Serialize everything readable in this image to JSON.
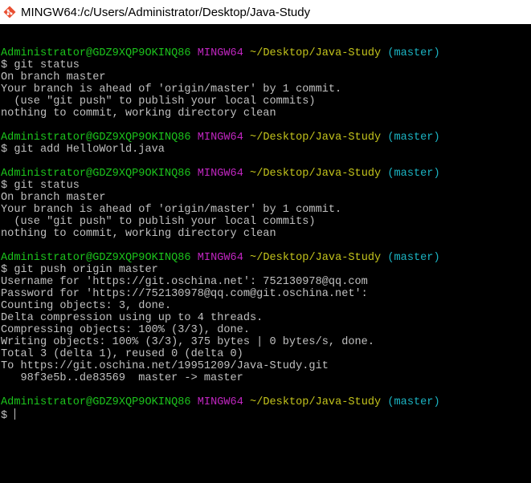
{
  "window": {
    "title": "MINGW64:/c/Users/Administrator/Desktop/Java-Study"
  },
  "colors": {
    "user": "#1cc51c",
    "host": "#c026c0",
    "path": "#c4c41c",
    "branch": "#1cb5c4",
    "text": "#c0c0c0",
    "background": "#000000"
  },
  "prompt": {
    "user": "Administrator@GDZ9XQP9OKINQ86",
    "host": "MINGW64",
    "path": "~/Desktop/Java-Study",
    "branch": "(master)"
  },
  "terminal": {
    "lines": [
      {
        "type": "blank"
      },
      {
        "type": "prompt"
      },
      {
        "type": "text",
        "text": "$ git status"
      },
      {
        "type": "text",
        "text": "On branch master"
      },
      {
        "type": "text",
        "text": "Your branch is ahead of 'origin/master' by 1 commit."
      },
      {
        "type": "text",
        "text": "  (use \"git push\" to publish your local commits)"
      },
      {
        "type": "text",
        "text": "nothing to commit, working directory clean"
      },
      {
        "type": "blank"
      },
      {
        "type": "prompt"
      },
      {
        "type": "text",
        "text": "$ git add HelloWorld.java"
      },
      {
        "type": "blank"
      },
      {
        "type": "prompt"
      },
      {
        "type": "text",
        "text": "$ git status"
      },
      {
        "type": "text",
        "text": "On branch master"
      },
      {
        "type": "text",
        "text": "Your branch is ahead of 'origin/master' by 1 commit."
      },
      {
        "type": "text",
        "text": "  (use \"git push\" to publish your local commits)"
      },
      {
        "type": "text",
        "text": "nothing to commit, working directory clean"
      },
      {
        "type": "blank"
      },
      {
        "type": "prompt"
      },
      {
        "type": "text",
        "text": "$ git push origin master"
      },
      {
        "type": "text",
        "text": "Username for 'https://git.oschina.net': 752130978@qq.com"
      },
      {
        "type": "text",
        "text": "Password for 'https://752130978@qq.com@git.oschina.net':"
      },
      {
        "type": "text",
        "text": "Counting objects: 3, done."
      },
      {
        "type": "text",
        "text": "Delta compression using up to 4 threads."
      },
      {
        "type": "text",
        "text": "Compressing objects: 100% (3/3), done."
      },
      {
        "type": "text",
        "text": "Writing objects: 100% (3/3), 375 bytes | 0 bytes/s, done."
      },
      {
        "type": "text",
        "text": "Total 3 (delta 1), reused 0 (delta 0)"
      },
      {
        "type": "text",
        "text": "To https://git.oschina.net/19951209/Java-Study.git"
      },
      {
        "type": "text",
        "text": "   98f3e5b..de83569  master -> master"
      },
      {
        "type": "blank"
      },
      {
        "type": "prompt"
      },
      {
        "type": "input",
        "text": "$ "
      }
    ]
  }
}
